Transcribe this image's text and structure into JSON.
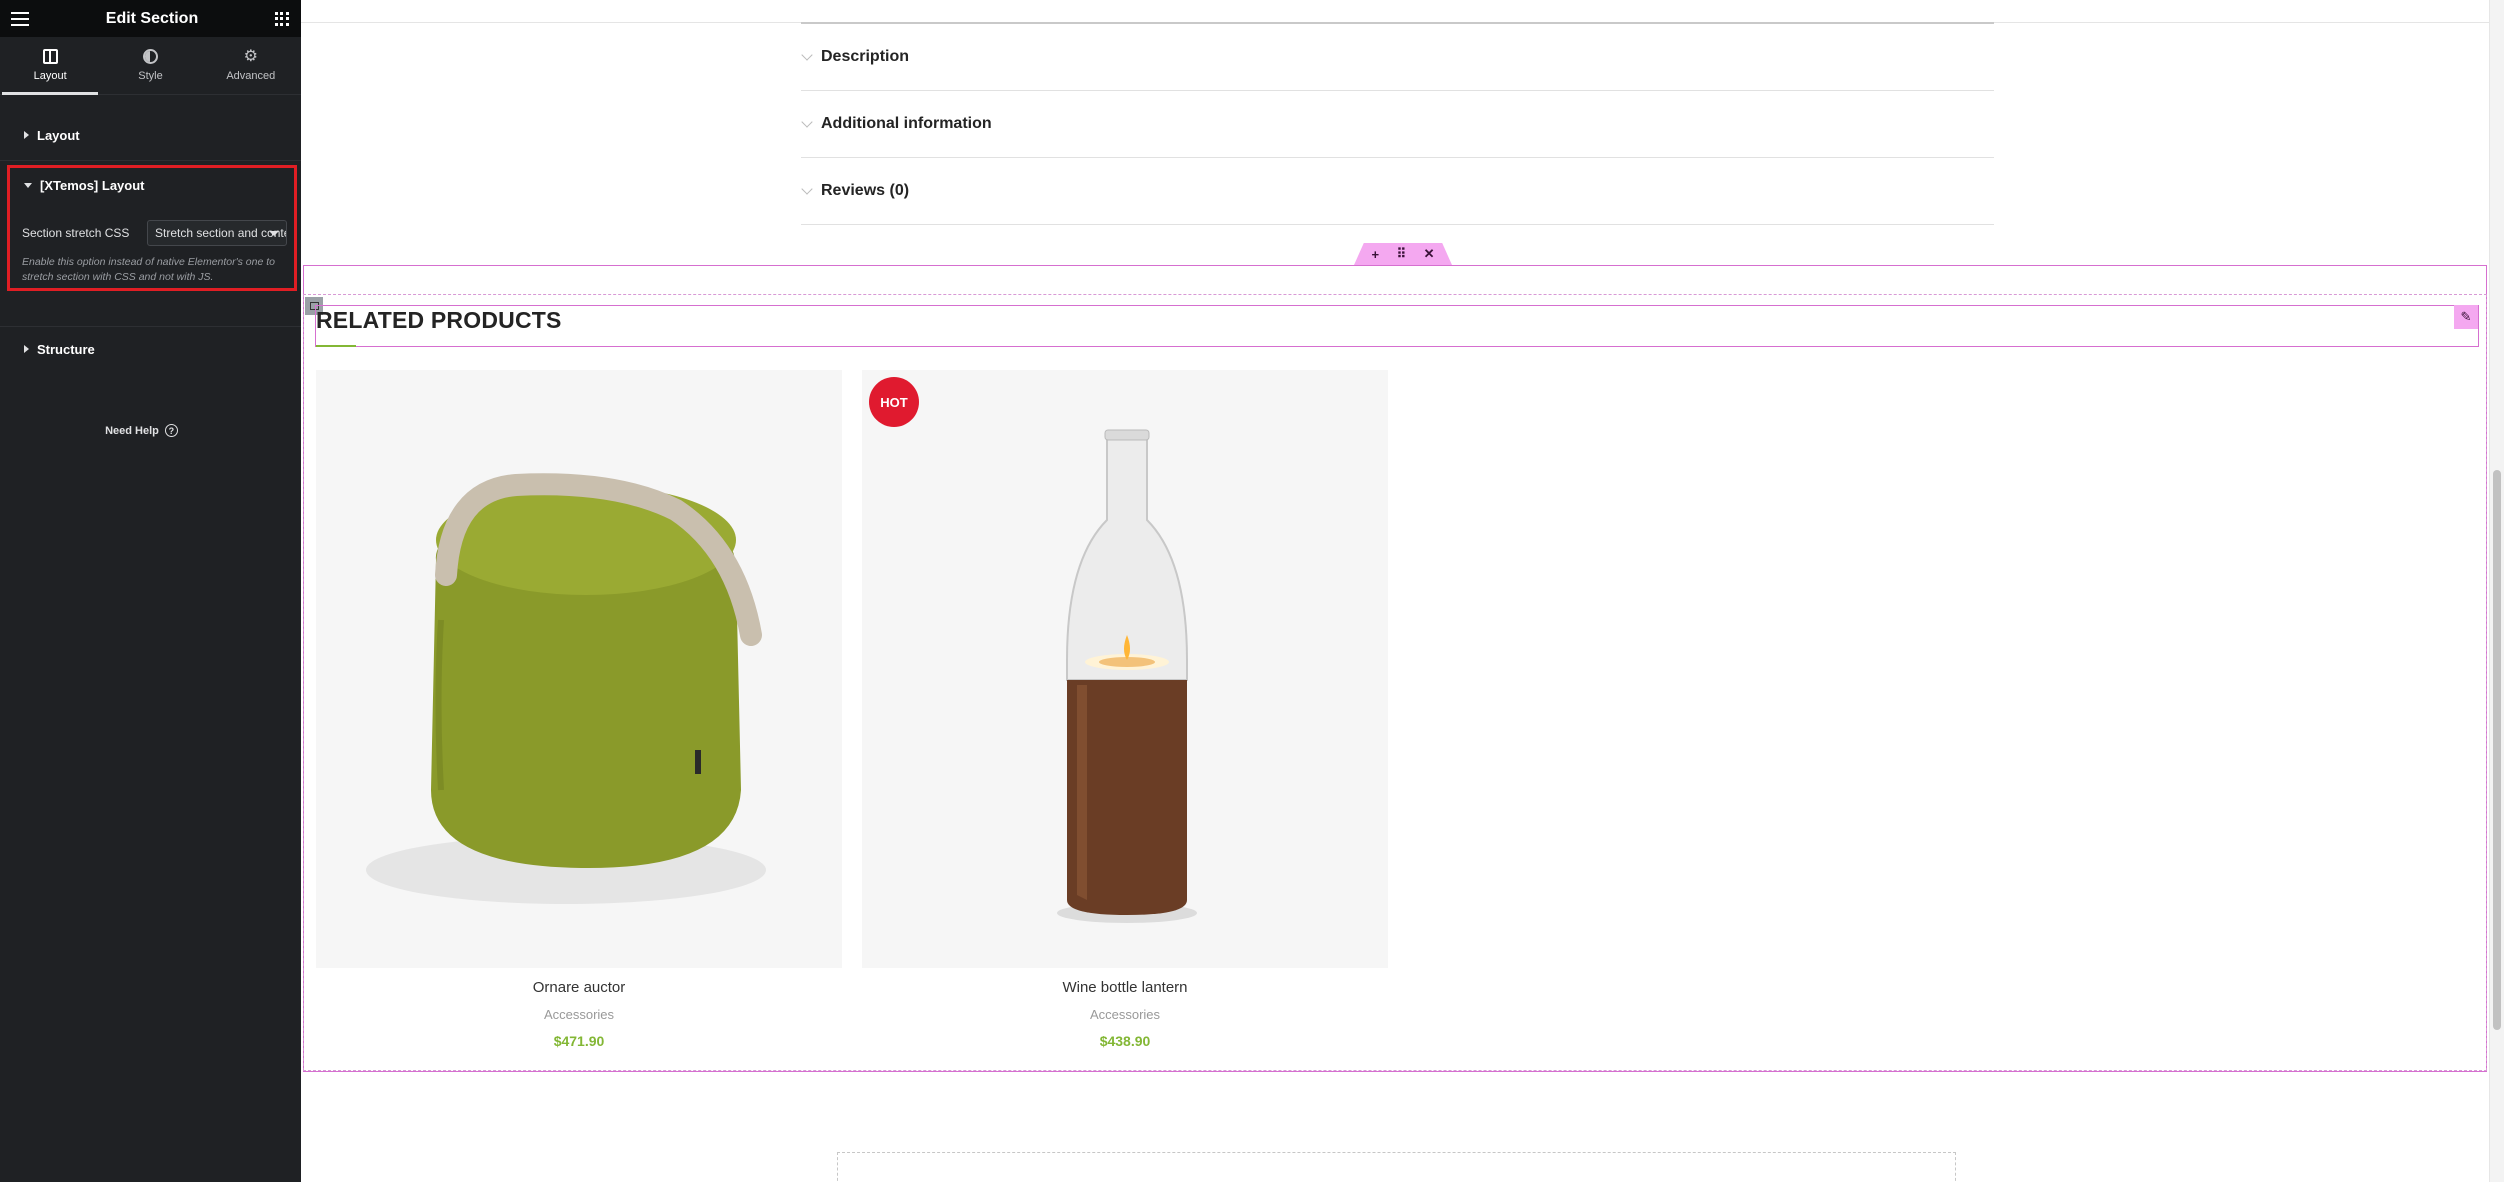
{
  "panel": {
    "title": "Edit Section",
    "tabs": [
      {
        "label": "Layout",
        "icon": "layout-icon",
        "active": true
      },
      {
        "label": "Style",
        "icon": "style-icon",
        "active": false
      },
      {
        "label": "Advanced",
        "icon": "gear-icon",
        "active": false
      }
    ],
    "sections": {
      "layout": "Layout",
      "xtemos": "[XTemos] Layout",
      "structure": "Structure"
    },
    "stretch": {
      "label": "Section stretch CSS",
      "value": "Stretch section and content",
      "help": "Enable this option instead of native Elementor's one to stretch section with CSS and not with JS."
    },
    "need_help": "Need Help",
    "help_icon_glyph": "?"
  },
  "colors": {
    "panel_bg": "#1f2124",
    "highlight_border": "#e01e24",
    "price": "#83b735",
    "hot_badge": "#e01a2f",
    "elementor_outline": "#d66fd0"
  },
  "accordion": [
    {
      "label": "Description"
    },
    {
      "label": "Additional information"
    },
    {
      "label": "Reviews (0)"
    }
  ],
  "section_controls": {
    "add": "+",
    "move": "⠿",
    "delete": "✕"
  },
  "related": {
    "title": "RELATED PRODUCTS",
    "products": [
      {
        "name": "Ornare auctor",
        "category": "Accessories",
        "price": "$471.90",
        "badge": ""
      },
      {
        "name": "Wine bottle lantern",
        "category": "Accessories",
        "price": "$438.90",
        "badge": "HOT"
      }
    ]
  }
}
